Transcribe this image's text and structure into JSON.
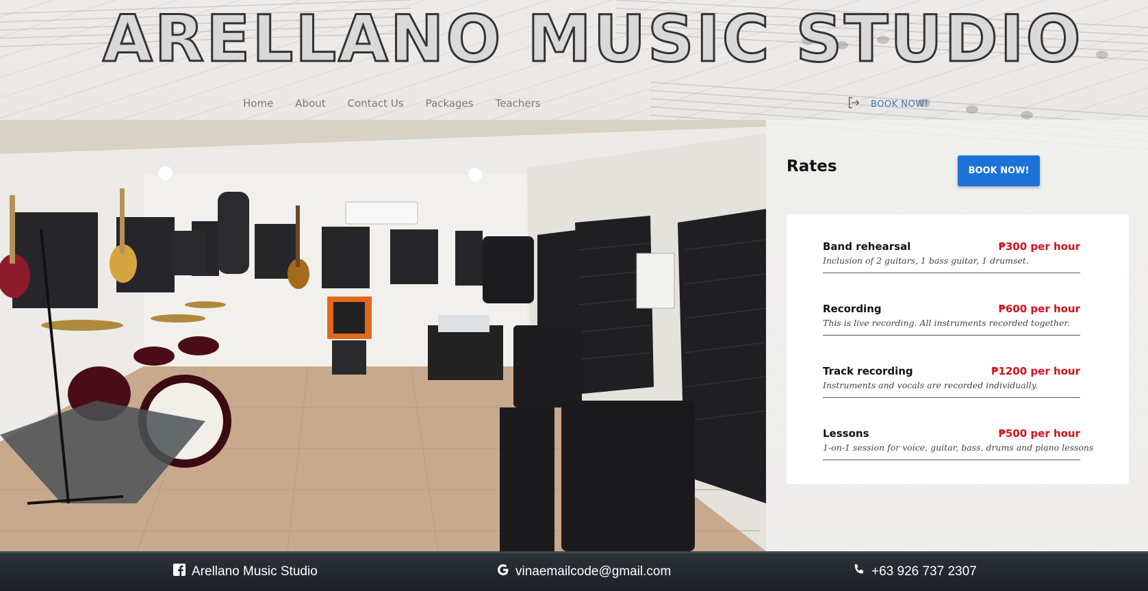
{
  "site": {
    "title": "ARELLANO MUSIC STUDIO"
  },
  "nav": {
    "items": [
      "Home",
      "About",
      "Contact Us",
      "Packages",
      "Teachers"
    ],
    "book_label": "BOOK NOW!"
  },
  "rates": {
    "title": "Rates",
    "button_label": "BOOK NOW!",
    "items": [
      {
        "name": "Band rehearsal",
        "price": "₱300 per hour",
        "desc": "Inclusion of 2 guitars, 1 bass guitar, 1 drumset."
      },
      {
        "name": "Recording",
        "price": "₱600 per hour",
        "desc": "This is live recording. All instruments recorded together."
      },
      {
        "name": "Track recording",
        "price": "₱1200 per hour",
        "desc": "Instruments and vocals are recorded individually."
      },
      {
        "name": "Lessons",
        "price": "₱500 per hour",
        "desc": "1-on-1 session for voice, guitar, bass, drums and piano lessons"
      }
    ]
  },
  "footer": {
    "facebook": "Arellano Music Studio",
    "email": "vinaemailcode@gmail.com",
    "phone": "+63 926 737 2307"
  },
  "icons": {
    "facebook": "facebook-icon",
    "google": "google-icon",
    "phone": "phone-icon",
    "login": "login-icon"
  },
  "colors": {
    "accent": "#1d72d8",
    "price": "#d0121d",
    "nav_link": "#7a7a7a",
    "footer_bg": "#23292e"
  }
}
